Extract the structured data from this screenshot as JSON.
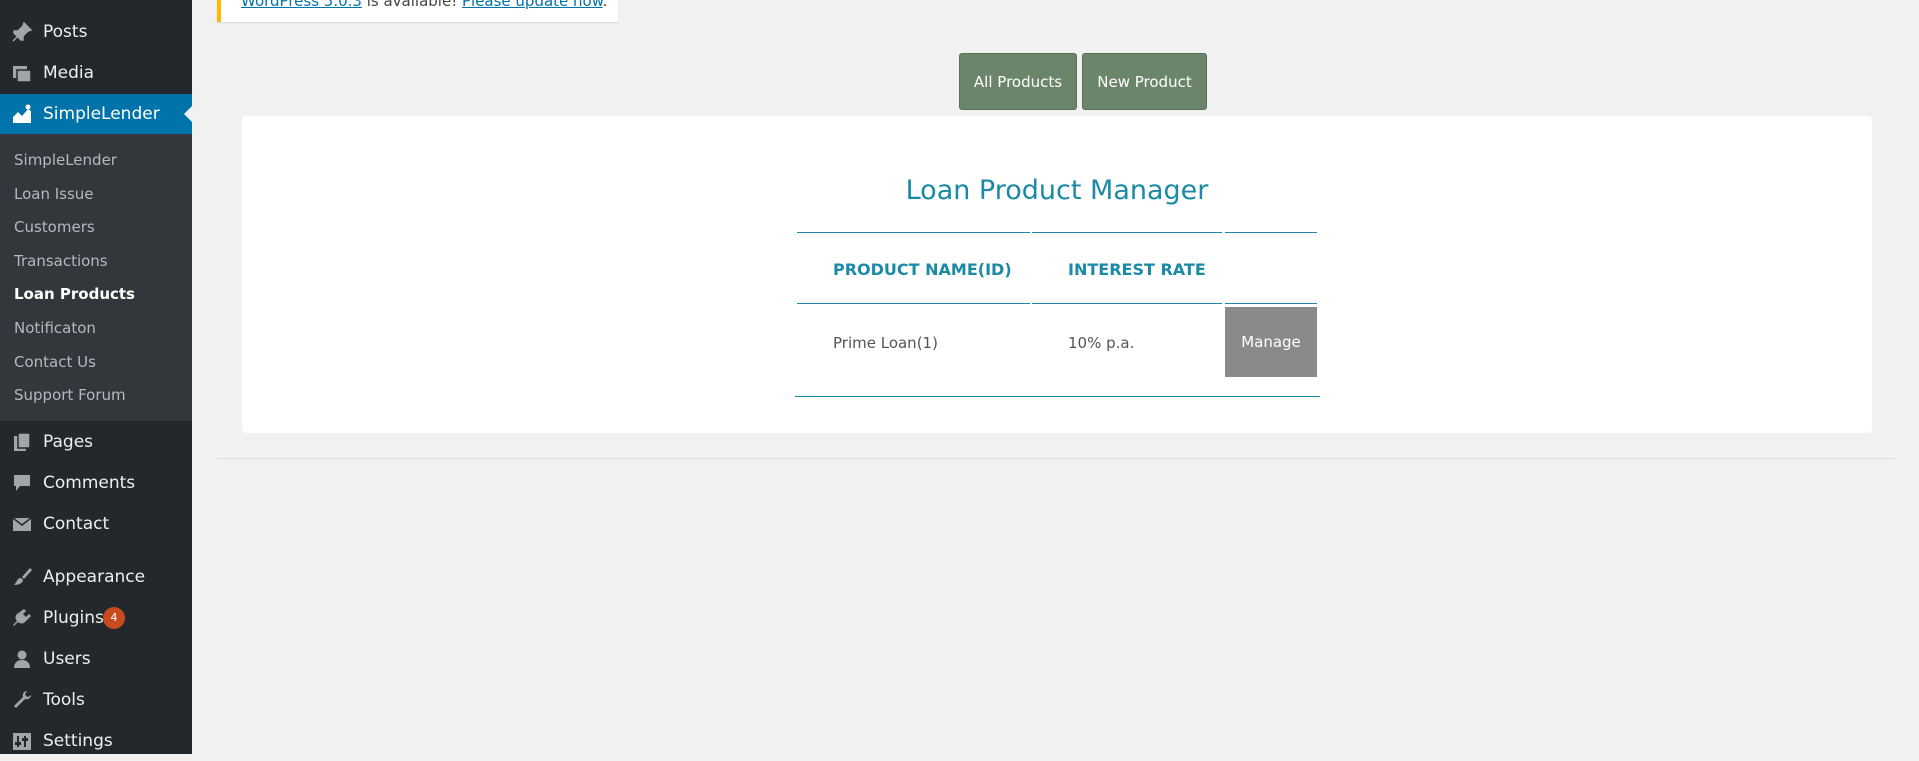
{
  "sidebar": {
    "menu": [
      {
        "label": "Posts",
        "icon": "pin-icon"
      },
      {
        "label": "Media",
        "icon": "media-icon"
      },
      {
        "label": "SimpleLender",
        "icon": "chart-icon"
      },
      {
        "label": "Pages",
        "icon": "pages-icon"
      },
      {
        "label": "Comments",
        "icon": "comment-icon"
      },
      {
        "label": "Contact",
        "icon": "mail-icon"
      },
      {
        "label": "Appearance",
        "icon": "brush-icon"
      },
      {
        "label": "Plugins",
        "icon": "plugin-icon",
        "badge": "4"
      },
      {
        "label": "Users",
        "icon": "user-icon"
      },
      {
        "label": "Tools",
        "icon": "wrench-icon"
      },
      {
        "label": "Settings",
        "icon": "settings-icon"
      }
    ],
    "submenu": [
      "SimpleLender",
      "Loan Issue",
      "Customers",
      "Transactions",
      "Loan Products",
      "Notificaton",
      "Contact Us",
      "Support Forum"
    ]
  },
  "notice": {
    "link1": "WordPress 5.0.3",
    "middle": " is available! ",
    "link2": "Please update now",
    "end": "."
  },
  "buttons": {
    "all_products": "All Products",
    "new_product": "New Product"
  },
  "panel": {
    "title": "Loan Product Manager",
    "headers": [
      "PRODUCT NAME(ID)",
      "INTEREST RATE"
    ],
    "rows": [
      {
        "name": "Prime Loan(1)",
        "rate": "10% p.a.",
        "action": "Manage"
      }
    ]
  },
  "colors": {
    "sidebar_bg": "#23282d",
    "submenu_bg": "#32373c",
    "active": "#0073aa",
    "button_green": "#6b856a",
    "title_teal": "#1a8aa6",
    "manage_gray": "#8a8a8a",
    "badge": "#ca4a1f",
    "notice_border": "#ffb900"
  }
}
